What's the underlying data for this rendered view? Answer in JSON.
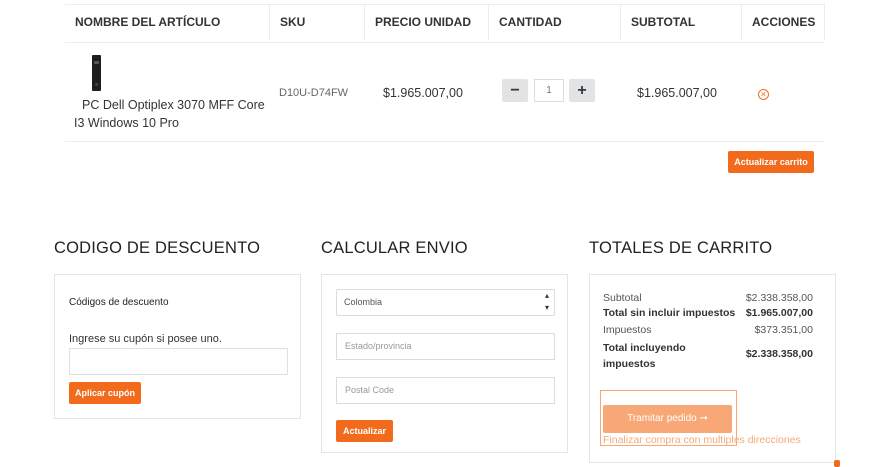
{
  "cart": {
    "headers": [
      "NOMBRE DEL ARTÍCULO",
      "SKU",
      "PRECIO UNIDAD",
      "CANTIDAD",
      "SUBTOTAL",
      "ACCIONES"
    ],
    "item": {
      "name": "PC Dell Optiplex 3070 MFF Core I3 Windows 10 Pro",
      "sku": "D10U-D74FW",
      "unit_price": "$1.965.007,00",
      "quantity": "1",
      "subtotal": "$1.965.007,00",
      "qty_minus": "−",
      "qty_plus": "+",
      "remove_symbol": "×",
      "remove_icon": "remove-circle-icon"
    },
    "update_label": "Actualizar carrito"
  },
  "coupon": {
    "title": "CODIGO DE DESCUENTO",
    "label": "Códigos de descuento",
    "hint": "Ingrese su cupón si posee uno.",
    "input_value": "",
    "apply_label": "Aplicar cupón"
  },
  "shipping": {
    "title": "CALCULAR ENVIO",
    "country": "Colombia",
    "select_arrow": "▴▾",
    "state_placeholder": "Estado/provincia",
    "postal_placeholder": "Postal Code",
    "update_label": "Actualizar"
  },
  "totals": {
    "title": "TOTALES DE CARRITO",
    "rows": [
      {
        "label": "Subtotal",
        "value": "$2.338.358,00"
      },
      {
        "label": "Total sin incluir impuestos",
        "value": "$1.965.007,00"
      },
      {
        "label": "Impuestos",
        "value": "$373.351,00"
      },
      {
        "label": "Total incluyendo impuestos",
        "value": "$2.338.358,00"
      }
    ],
    "checkout_label": "Tramitar pedido ➞",
    "multi_address_label": "Finalizar compra con multiples direcciones"
  },
  "colors": {
    "accent": "#f26b1d",
    "accent_light": "#f7a876",
    "border": "#e5e5e5"
  }
}
